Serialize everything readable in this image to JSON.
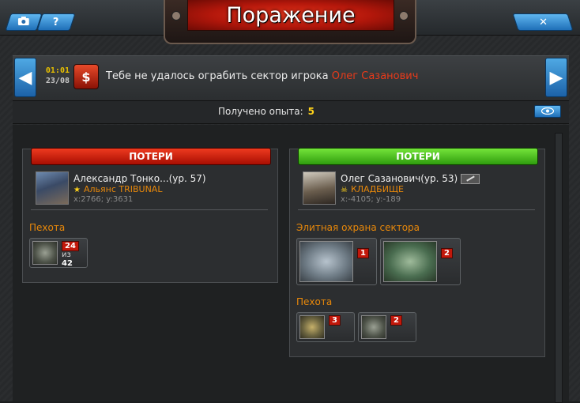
{
  "window": {
    "title": "Поражение",
    "close_icon": "close-icon",
    "camera_icon": "camera-icon",
    "help_label": "?",
    "close_label": "✕"
  },
  "report": {
    "time": "01:01",
    "date": "23/08",
    "icon_label": "$",
    "message": "Тебе не удалось ограбить сектор игрока ",
    "enemy_name": "Олег Сазанович",
    "experience_label": "Получено опыта:",
    "experience_value": "5",
    "prev_label": "◀",
    "next_label": "▶",
    "eye_label": "👁"
  },
  "left": {
    "header": "ПОТЕРИ",
    "player_name": "Александр Тонко...(ур. 57)",
    "alliance": "Альянс TRIBUNAL",
    "coords": "x:2766; y:3631",
    "section": "Пехота",
    "units": [
      {
        "kind": "soldier",
        "lost": "24",
        "of_label": "из",
        "total": "42"
      }
    ]
  },
  "right": {
    "header": "ПОТЕРИ",
    "player_name": "Олег Сазанович(ур. 53)",
    "alliance": "КЛАДБИЩЕ",
    "coords": "x:-4105; y:-189",
    "section_elite": "Элитная охрана сектора",
    "elite_units": [
      {
        "kind": "drone",
        "lost": "1"
      },
      {
        "kind": "walker",
        "lost": "2"
      }
    ],
    "section_infantry": "Пехота",
    "infantry_units": [
      {
        "kind": "mech",
        "lost": "3"
      },
      {
        "kind": "soldier",
        "lost": "2"
      }
    ]
  }
}
